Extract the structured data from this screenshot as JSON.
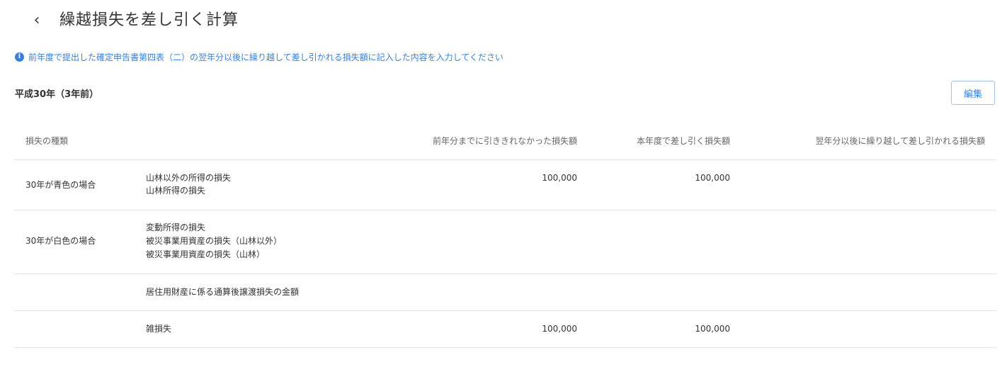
{
  "header": {
    "back_icon": "chevron-left-icon",
    "back_glyph": "‹",
    "title": "繰越損失を差し引く計算"
  },
  "info": {
    "icon": "info-icon",
    "icon_glyph": "i",
    "text": "前年度で提出した確定申告書第四表（二）の翌年分以後に繰り越して差し引かれる損失額に記入した内容を入力してください",
    "color": "#3a80d8"
  },
  "section": {
    "title": "平成30年（3年前）",
    "edit_label": "編集"
  },
  "table": {
    "headers": {
      "type": "損失の種類",
      "prev": "前年分までに引ききれなかった損失額",
      "current": "本年度で差し引く損失額",
      "next": "翌年分以後に繰り越して差し引かれる損失額"
    },
    "rows": [
      {
        "group": "30年が青色の場合",
        "items": [
          "山林以外の所得の損失",
          "山林所得の損失"
        ],
        "prev": "100,000",
        "current": "100,000",
        "next": ""
      },
      {
        "group": "30年が白色の場合",
        "items": [
          "変動所得の損失",
          "被災事業用資産の損失（山林以外）",
          "被災事業用資産の損失（山林）"
        ],
        "prev": "",
        "current": "",
        "next": ""
      },
      {
        "group": "",
        "items": [
          "居住用財産に係る通算後譲渡損失の金額"
        ],
        "prev": "",
        "current": "",
        "next": ""
      },
      {
        "group": "",
        "items": [
          "雑損失"
        ],
        "prev": "100,000",
        "current": "100,000",
        "next": ""
      }
    ]
  }
}
